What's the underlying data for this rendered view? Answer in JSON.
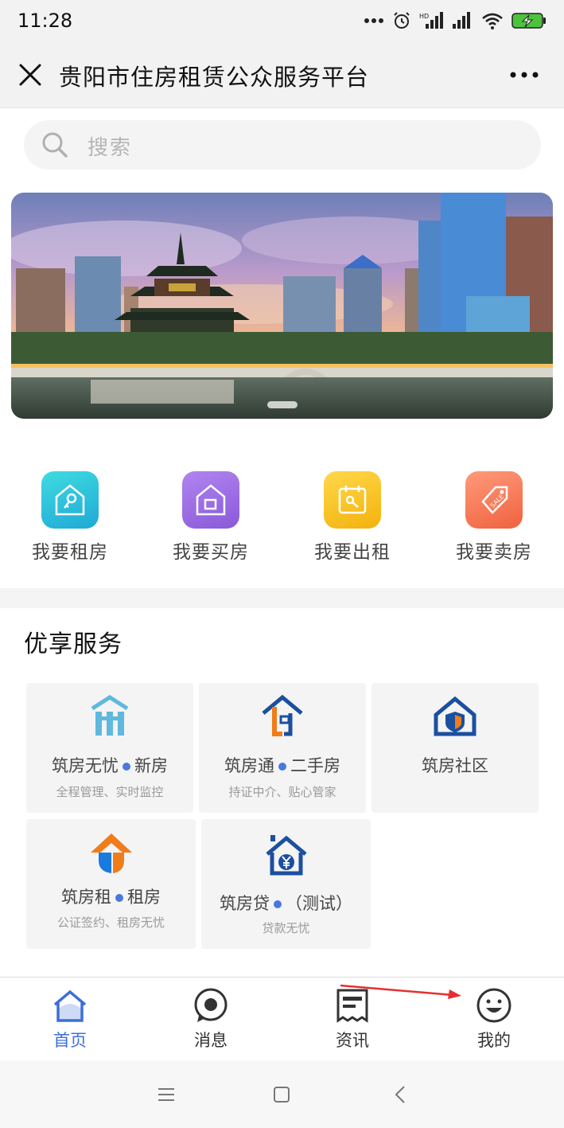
{
  "status_bar": {
    "time": "11:28"
  },
  "header": {
    "title": "贵阳市住房租赁公众服务平台"
  },
  "search": {
    "placeholder": "搜索"
  },
  "quick_entries": [
    {
      "label": "我要租房",
      "icon": "house-key-icon",
      "color": "#2bc3d8"
    },
    {
      "label": "我要买房",
      "icon": "house-window-icon",
      "color": "#9a6be3"
    },
    {
      "label": "我要出租",
      "icon": "calendar-key-icon",
      "color": "#f5c21c"
    },
    {
      "label": "我要卖房",
      "icon": "sale-tag-icon",
      "color": "#f27a5a"
    }
  ],
  "services": {
    "title": "优享服务",
    "items": [
      {
        "name": "筑房无忧",
        "tag": "新房",
        "sub": "全程管理、实时监控",
        "icon": "new-house-icon"
      },
      {
        "name": "筑房通",
        "tag": "二手房",
        "sub": "持证中介、贴心管家",
        "icon": "second-hand-house-icon"
      },
      {
        "name": "筑房社区",
        "tag": "",
        "sub": "",
        "icon": "community-shield-icon"
      },
      {
        "name": "筑房租",
        "tag": "租房",
        "sub": "公证签约、租房无忧",
        "icon": "rent-house-icon"
      },
      {
        "name": "筑房贷",
        "tag": "（测试）",
        "sub": "贷款无忧",
        "icon": "loan-house-icon"
      }
    ]
  },
  "tabs": [
    {
      "label": "首页",
      "icon": "home-icon",
      "active": true
    },
    {
      "label": "消息",
      "icon": "message-icon",
      "active": false
    },
    {
      "label": "资讯",
      "icon": "news-icon",
      "active": false
    },
    {
      "label": "我的",
      "icon": "smiley-icon",
      "active": false
    }
  ],
  "colors": {
    "accent": "#3d6fd8",
    "service_blue": "#1b4fa0",
    "service_orange": "#f07d1a",
    "annotation": "#e53030"
  }
}
